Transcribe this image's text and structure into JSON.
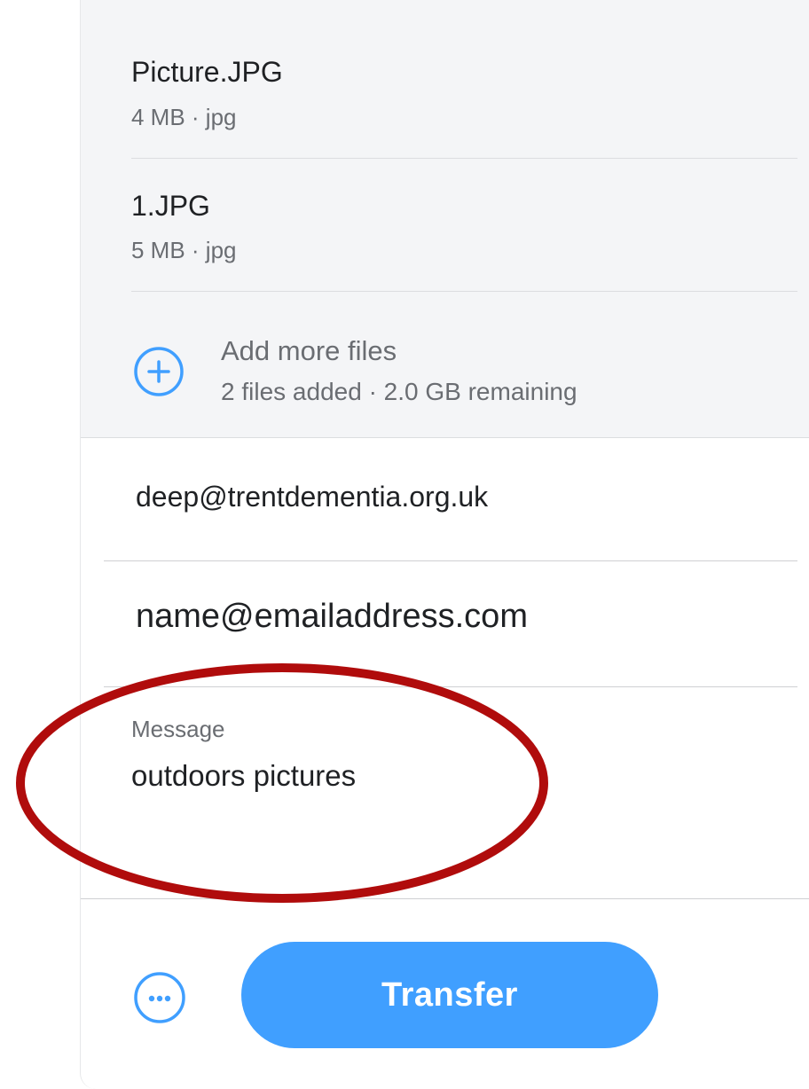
{
  "files": [
    {
      "name": "Picture.JPG",
      "meta": "4 MB · jpg"
    },
    {
      "name": "1.JPG",
      "meta": "5 MB · jpg"
    }
  ],
  "add_more": {
    "label": "Add more files",
    "status": "2 files added · 2.0 GB remaining",
    "icon": "plus-circle-icon"
  },
  "form": {
    "email_to": "deep@trentdementia.org.uk",
    "email_from": "name@emailaddress.com",
    "message_label": "Message",
    "message_value": "outdoors pictures"
  },
  "actions": {
    "more_icon": "ellipsis-circle-icon",
    "transfer_label": "Transfer"
  },
  "colors": {
    "accent": "#409fff",
    "annotation": "#b00c0c",
    "files_background": "#f4f5f7"
  }
}
